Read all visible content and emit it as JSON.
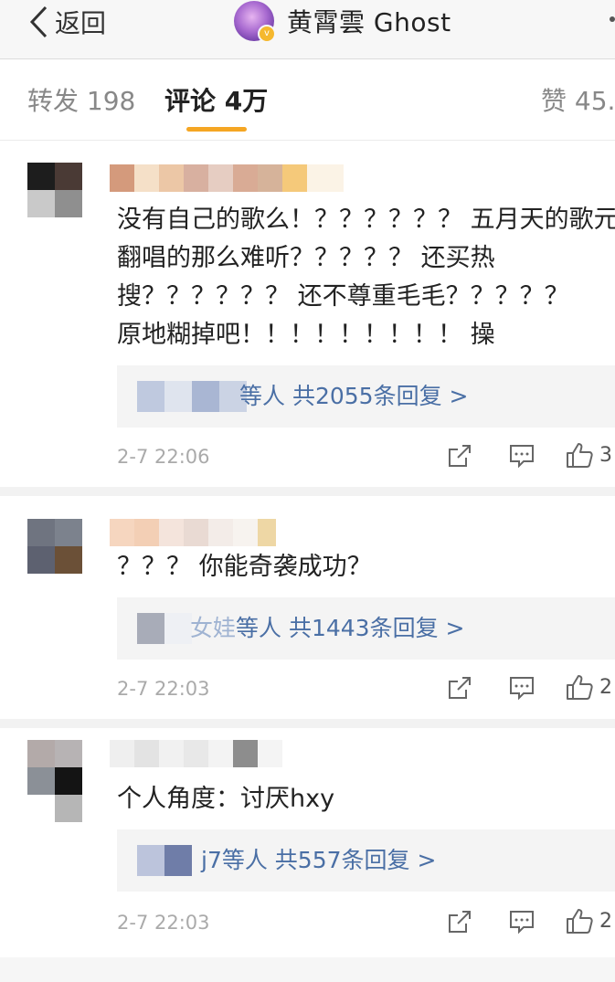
{
  "nav": {
    "back_label": "返回",
    "title": "黄霄雲 Ghost",
    "badge": "v"
  },
  "tabs": {
    "repost": "转发 198",
    "comments": "评论 4万",
    "likes": "赞 45.",
    "accent": "#f5a623"
  },
  "comments": [
    {
      "lines": [
        "没有自己的歌么！？？？？？？ 五月天的歌元",
        "翻唱的那么难听？？？？？ 还买热",
        "搜？？？？？？ 还不尊重毛毛？？？？？",
        "原地糊掉吧！！！！！！！！！ 操"
      ],
      "reply_prefix": "",
      "reply_text": "等人 共2055条回复 >",
      "time": "2-7 22:06",
      "likes": "3"
    },
    {
      "lines": [
        "？？？ 你能奇袭成功？"
      ],
      "reply_prefix": "女娃",
      "reply_text": "等人 共1443条回复 >",
      "time": "2-7 22:03",
      "likes": "2"
    },
    {
      "lines": [
        "个人角度：讨厌hxy"
      ],
      "reply_prefix": "",
      "reply_text": "j7等人 共557条回复 >",
      "time": "2-7 22:03",
      "likes": "2"
    }
  ],
  "icons": {
    "back": "chevron-left-icon",
    "share": "share-icon",
    "comment": "comment-icon",
    "like": "thumbs-up-icon"
  },
  "colors": {
    "link": "#4a6fa5",
    "time": "#aaaaaa"
  }
}
